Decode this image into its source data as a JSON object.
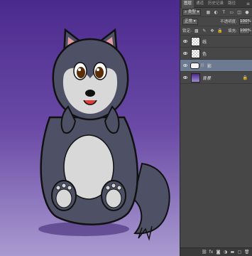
{
  "panel": {
    "tabs": [
      {
        "label": "图层"
      },
      {
        "label": "通道"
      },
      {
        "label": "历史记录"
      },
      {
        "label": "路径"
      }
    ],
    "menu_icon": "hamburger-menu-icon",
    "filter_kind": "类型",
    "blend_mode": "正常",
    "opacity_label": "不透明度:",
    "opacity_value": "100%",
    "lock_label": "锁定:",
    "fill_label": "填充:",
    "fill_value": "100%"
  },
  "layers": [
    {
      "name": "线",
      "selected": false,
      "visible": true,
      "thumb": "checker"
    },
    {
      "name": "色",
      "selected": false,
      "visible": true,
      "thumb": "checker"
    },
    {
      "name": "影",
      "selected": true,
      "visible": true,
      "thumb": "mask"
    },
    {
      "name": "背景",
      "selected": false,
      "visible": true,
      "thumb": "bg",
      "locked": true
    }
  ],
  "bottom_icons": [
    "link-layers-icon",
    "fx-icon",
    "add-mask-icon",
    "adjustment-layer-icon",
    "new-group-icon",
    "new-layer-icon",
    "trash-icon"
  ],
  "colors": {
    "canvas_top": "#4b2a8e",
    "canvas_bottom": "#a99ad0",
    "fur": "#4e5166",
    "fur_light": "#d8d8d8",
    "selected_layer": "#6c7b92"
  }
}
